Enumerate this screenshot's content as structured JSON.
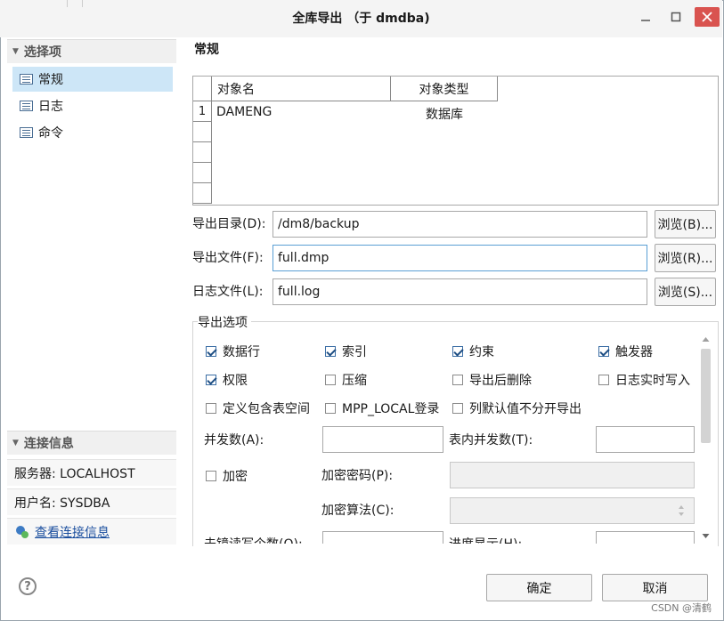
{
  "window": {
    "title": "全库导出 （于 dmdba)"
  },
  "left": {
    "options_header": "选择项",
    "nav": [
      {
        "label": "常规",
        "selected": true
      },
      {
        "label": "日志",
        "selected": false
      },
      {
        "label": "命令",
        "selected": false
      }
    ],
    "conn_header": "连接信息",
    "server": "服务器: LOCALHOST",
    "user": "用户名: SYSDBA",
    "view_link": "查看连接信息"
  },
  "page": {
    "title": "常规",
    "table": {
      "columns": [
        "对象名",
        "对象类型"
      ],
      "rows": [
        {
          "num": "1",
          "name": "DAMENG",
          "type": "数据库"
        }
      ]
    },
    "fields": {
      "dir_label": "导出目录(D):",
      "dir_value": "/dm8/backup",
      "dir_browse": "浏览(B)...",
      "file_label": "导出文件(F):",
      "file_value": "full.dmp",
      "file_browse": "浏览(R)...",
      "log_label": "日志文件(L):",
      "log_value": "full.log",
      "log_browse": "浏览(S)..."
    },
    "options": {
      "group_title": "导出选项",
      "checks": {
        "rows": "数据行",
        "index": "索引",
        "constraint": "约束",
        "trigger": "触发器",
        "grant": "权限",
        "compress": "压缩",
        "delete_after": "导出后删除",
        "log_realtime": "日志实时写入",
        "tablespace": "定义包含表空间",
        "mpp_local": "MPP_LOCAL登录",
        "default_separate": "列默认值不分开导出",
        "encrypt": "加密"
      },
      "parallel_label": "并发数(A):",
      "table_parallel_label": "表内并发数(T):",
      "enc_pwd_label": "加密密码(P):",
      "enc_algo_label": "加密算法(C):",
      "cut_left_label": "未镜读写个数(O):",
      "cut_right_label": "进度显示(H):"
    }
  },
  "footer": {
    "ok": "确定",
    "cancel": "取消",
    "help": "?",
    "watermark": "CSDN @清鹤"
  }
}
